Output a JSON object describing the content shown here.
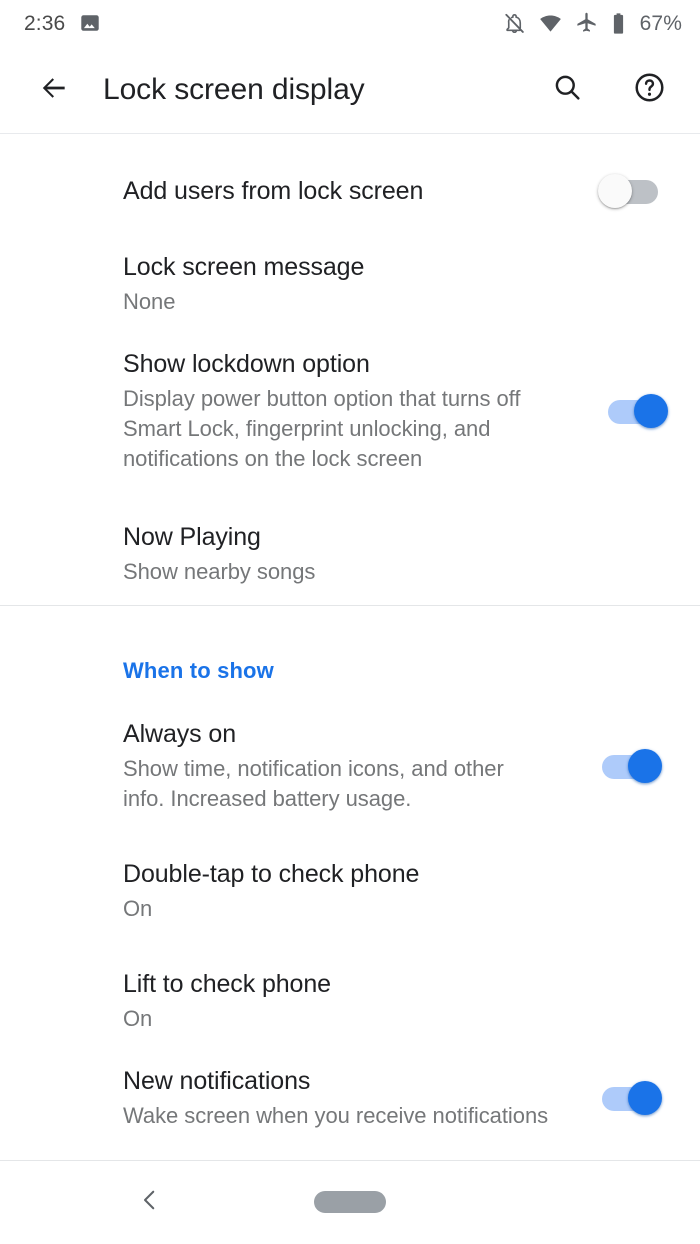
{
  "status_bar": {
    "time": "2:36",
    "battery_percent": "67%",
    "icons": {
      "notification": "image-screenshot-icon",
      "silent": "bell-slash-icon",
      "wifi": "wifi-icon",
      "airplane": "airplane-mode-icon",
      "battery": "battery-icon"
    }
  },
  "toolbar": {
    "title": "Lock screen display",
    "back_icon": "arrow-back-icon",
    "search_icon": "search-icon",
    "help_icon": "help-circle-icon"
  },
  "colors": {
    "accent": "#1a73e8",
    "switch_on_track": "#aecbfa",
    "switch_off_track": "#bdc1c6",
    "primary_text": "#202124",
    "secondary_text": "#757779"
  },
  "sections": [
    {
      "header": null,
      "items": [
        {
          "title": "Add users from lock screen",
          "summary": null,
          "control": "switch",
          "checked": false
        },
        {
          "title": "Lock screen message",
          "summary": "None",
          "control": "none",
          "checked": null
        },
        {
          "title": "Show lockdown option",
          "summary": "Display power button option that turns off Smart Lock, fingerprint unlocking, and notifications on the lock screen",
          "control": "switch",
          "checked": true
        },
        {
          "title": "Now Playing",
          "summary": "Show nearby songs",
          "control": "none",
          "checked": null
        }
      ]
    },
    {
      "header": "When to show",
      "items": [
        {
          "title": "Always on",
          "summary": "Show time, notification icons, and other info. Increased battery usage.",
          "control": "switch",
          "checked": true
        },
        {
          "title": "Double-tap to check phone",
          "summary": "On",
          "control": "none",
          "checked": null
        },
        {
          "title": "Lift to check phone",
          "summary": "On",
          "control": "none",
          "checked": null
        },
        {
          "title": "New notifications",
          "summary": "Wake screen when you receive notifications",
          "control": "switch",
          "checked": true
        }
      ]
    }
  ],
  "navbar": {
    "back_icon": "chevron-back-icon",
    "home_icon": "home-pill-icon"
  }
}
